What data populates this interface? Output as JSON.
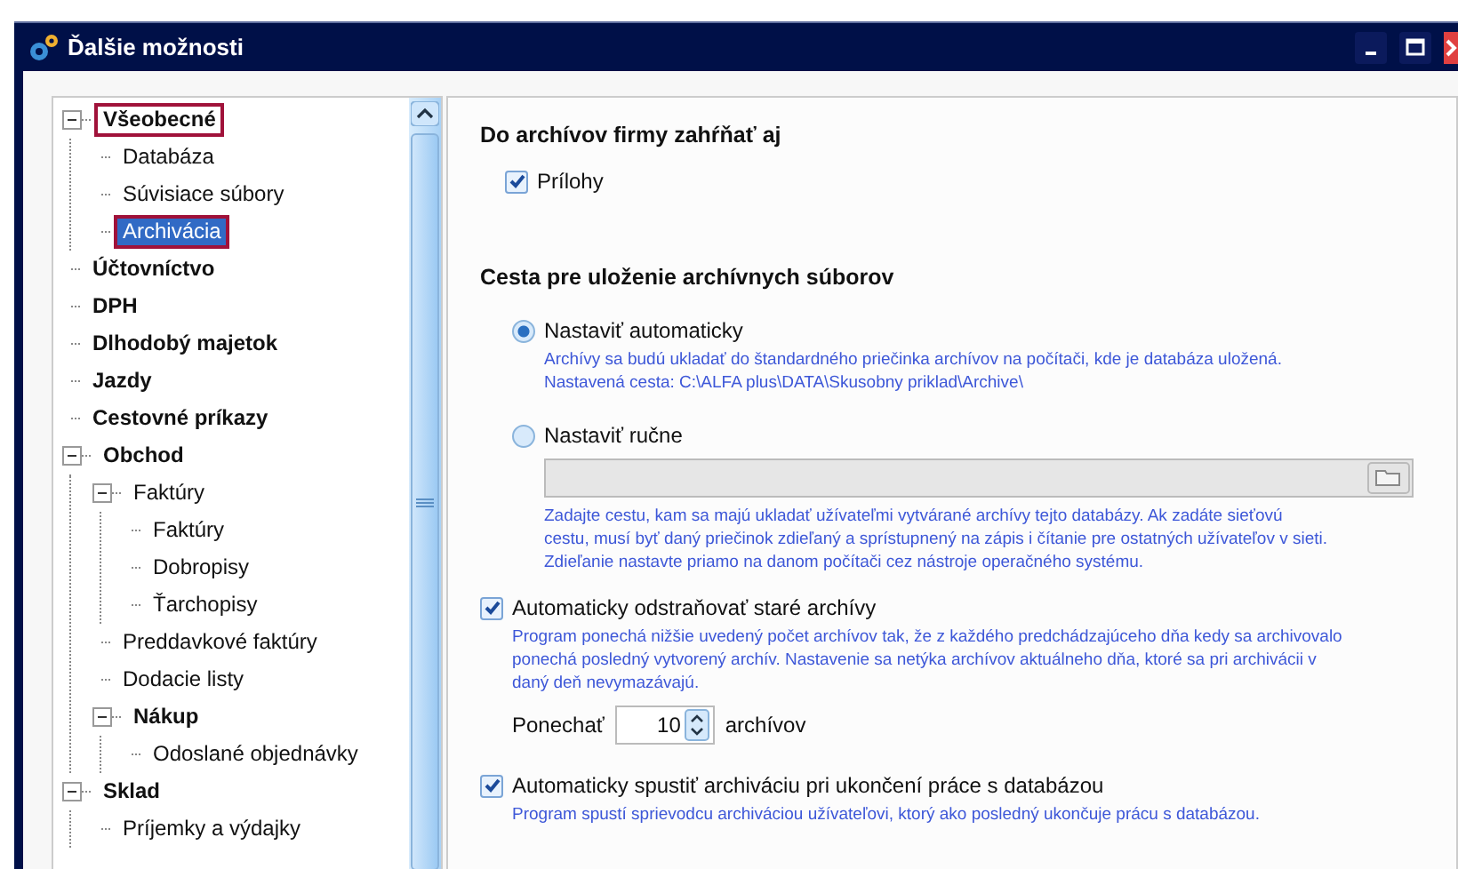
{
  "window": {
    "title": "Ďalšie možnosti"
  },
  "tree": [
    {
      "label": "Všeobecné",
      "bold": true,
      "expanded": true,
      "highlighted": true,
      "selected": false,
      "children": [
        {
          "label": "Databáza",
          "bold": false,
          "highlighted": false,
          "selected": false
        },
        {
          "label": "Súvisiace súbory",
          "bold": false,
          "highlighted": false,
          "selected": false
        },
        {
          "label": "Archivácia",
          "bold": false,
          "highlighted": true,
          "selected": true
        }
      ]
    },
    {
      "label": "Účtovníctvo",
      "bold": true,
      "highlighted": false,
      "selected": false
    },
    {
      "label": "DPH",
      "bold": true,
      "highlighted": false,
      "selected": false
    },
    {
      "label": "Dlhodobý majetok",
      "bold": true,
      "highlighted": false,
      "selected": false
    },
    {
      "label": "Jazdy",
      "bold": true,
      "highlighted": false,
      "selected": false
    },
    {
      "label": "Cestovné príkazy",
      "bold": true,
      "highlighted": false,
      "selected": false
    },
    {
      "label": "Obchod",
      "bold": true,
      "expanded": true,
      "highlighted": false,
      "selected": false,
      "children": [
        {
          "label": "Faktúry",
          "bold": false,
          "expanded": true,
          "highlighted": false,
          "selected": false,
          "children": [
            {
              "label": "Faktúry",
              "bold": false,
              "highlighted": false,
              "selected": false
            },
            {
              "label": "Dobropisy",
              "bold": false,
              "highlighted": false,
              "selected": false
            },
            {
              "label": "Ťarchopisy",
              "bold": false,
              "highlighted": false,
              "selected": false
            }
          ]
        },
        {
          "label": "Preddavkové faktúry",
          "bold": false,
          "highlighted": false,
          "selected": false
        },
        {
          "label": "Dodacie listy",
          "bold": false,
          "highlighted": false,
          "selected": false
        },
        {
          "label": "Nákup",
          "bold": true,
          "expanded": true,
          "highlighted": false,
          "selected": false,
          "children": [
            {
              "label": "Odoslané objednávky",
              "bold": false,
              "highlighted": false,
              "selected": false
            }
          ]
        }
      ]
    },
    {
      "label": "Sklad",
      "bold": true,
      "expanded": true,
      "highlighted": false,
      "selected": false,
      "children": [
        {
          "label": "Príjemky a výdajky",
          "bold": false,
          "highlighted": false,
          "selected": false
        }
      ]
    }
  ],
  "include_section": {
    "heading": "Do archívov firmy zahŕňať aj",
    "checkbox": {
      "label": "Prílohy",
      "checked": true
    }
  },
  "path_section": {
    "heading": "Cesta pre uloženie archívnych súborov",
    "options": [
      {
        "label": "Nastaviť automaticky",
        "selected": true,
        "description": [
          "Archívy sa budú ukladať do štandardného priečinka archívov na počítači, kde je databáza uložená.",
          "Nastavená cesta: C:\\ALFA plus\\DATA\\Skusobny priklad\\Archive\\"
        ]
      },
      {
        "label": "Nastaviť ručne",
        "selected": false,
        "description": [
          "Zadajte cestu, kam sa majú ukladať užívateľmi vytvárané archívy tejto databázy. Ak zadáte sieťovú",
          "cestu, musí byť daný priečinok zdieľaný a sprístupnený na zápis i čítanie pre ostatných užívateľov v sieti.",
          "Zdieľanie nastavte priamo na danom počítači cez nástroje operačného systému."
        ]
      }
    ]
  },
  "auto_delete": {
    "label": "Automaticky odstraňovať staré archívy",
    "checked": true,
    "description": [
      "Program ponechá nižšie uvedený počet archívov tak, že z každého predchádzajúceho dňa kedy sa archivovalo",
      "ponechá posledný vytvorený archív. Nastavenie sa netýka archívov aktuálneho dňa, ktoré sa pri archivácii v",
      "daný deň nevymazávajú."
    ],
    "keep_label": "Ponechať",
    "keep_value": "10",
    "keep_unit": "archívov"
  },
  "auto_archive": {
    "label": "Automaticky spustiť archiváciu pri ukončení práce s databázou",
    "checked": true,
    "description": [
      "Program spustí sprievodcu archiváciou užívateľovi, ktorý ako posledný ukončuje prácu s databázou."
    ]
  }
}
